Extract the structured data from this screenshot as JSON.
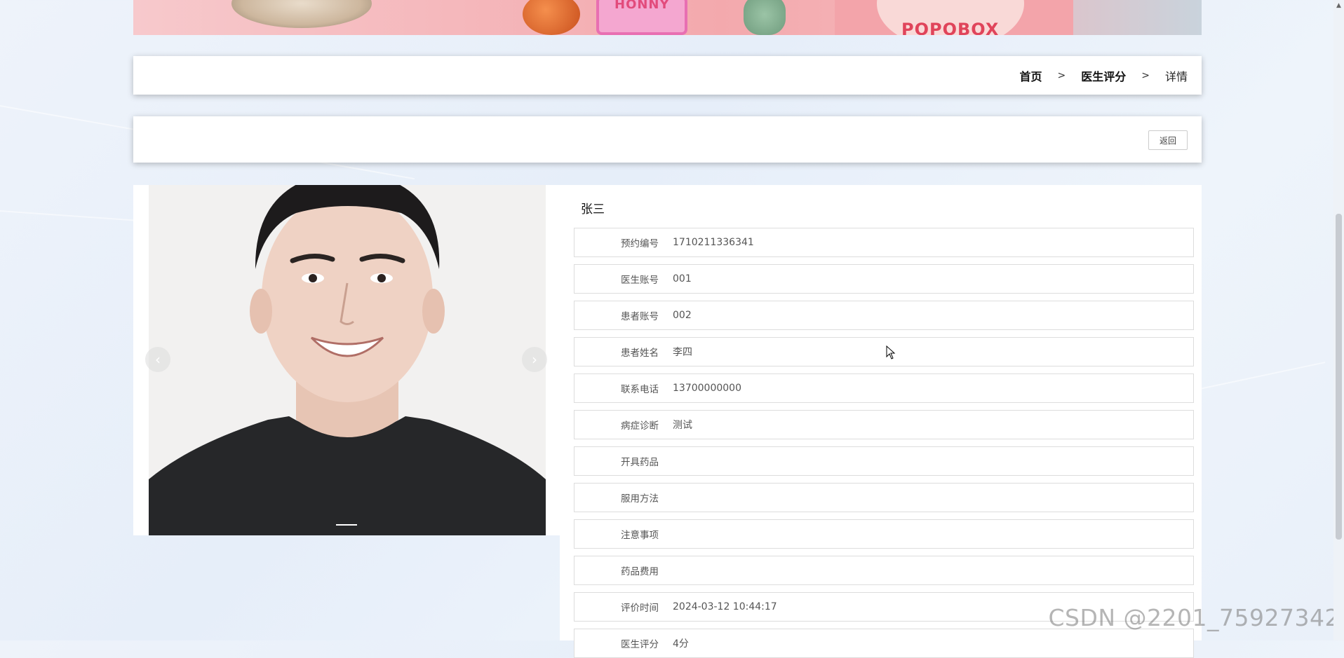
{
  "banner": {
    "toy_text": "HONNY",
    "brand": "POPOBOX"
  },
  "breadcrumb": {
    "home": "首页",
    "section": "医生评分",
    "current": "详情",
    "separator": ">"
  },
  "actions": {
    "back_label": "返回"
  },
  "gallery": {
    "prev_icon": "‹",
    "next_icon": "›"
  },
  "doctor_name": "张三",
  "fields": [
    {
      "label": "预约编号",
      "value": "1710211336341"
    },
    {
      "label": "医生账号",
      "value": "001"
    },
    {
      "label": "患者账号",
      "value": "002"
    },
    {
      "label": "患者姓名",
      "value": "李四"
    },
    {
      "label": "联系电话",
      "value": "13700000000"
    },
    {
      "label": "病症诊断",
      "value": "测试"
    },
    {
      "label": "开具药品",
      "value": ""
    },
    {
      "label": "服用方法",
      "value": ""
    },
    {
      "label": "注意事项",
      "value": ""
    },
    {
      "label": "药品费用",
      "value": ""
    },
    {
      "label": "评价时间",
      "value": "2024-03-12 10:44:17"
    },
    {
      "label": "医生评分",
      "value": "4分"
    }
  ],
  "watermark": "CSDN @2201_75927342",
  "scrollbar": {
    "up_icon": "▲"
  }
}
